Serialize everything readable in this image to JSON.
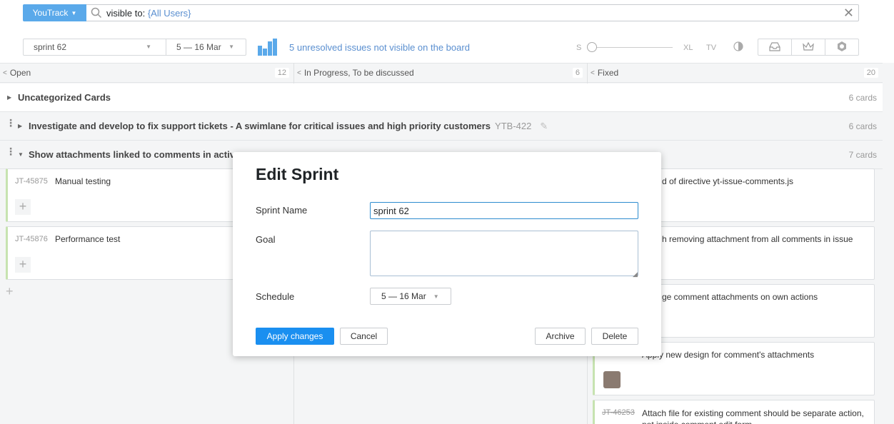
{
  "search": {
    "app_button": "YouTrack",
    "query_keyword": "visible to: ",
    "query_value": "{All Users}"
  },
  "toolbar": {
    "sprint": "sprint 62",
    "dates": "5 — 16 Mar",
    "unresolved_link": "5 unresolved issues not visible on the board",
    "size_s": "S",
    "size_xl": "XL",
    "size_tv": "TV"
  },
  "columns": [
    {
      "name": "Open",
      "count": "12"
    },
    {
      "name": "In Progress, To be discussed",
      "count": "6"
    },
    {
      "name": "Fixed",
      "count": "20"
    }
  ],
  "swimlanes": [
    {
      "title": "Uncategorized Cards",
      "cards": "6 cards"
    },
    {
      "title": "Investigate and develop to fix support tickets - A swimlane for critical issues and high priority customers",
      "id": "YTB-422",
      "cards": "6 cards"
    },
    {
      "title": "Show attachments linked to comments in activ",
      "cards": "7 cards"
    }
  ],
  "cards": [
    {
      "id": "JT-45875",
      "summary": "Manual testing"
    },
    {
      "id": "JT-45876",
      "summary": "Performance test"
    },
    {
      "summary": "d of directive yt-issue-comments.js"
    },
    {
      "summary": "h removing attachment from all comments in issue"
    },
    {
      "summary": "ge comment attachments on own actions"
    },
    {
      "summary": "Apply new design for comment's attachments"
    },
    {
      "id": "JT-46253",
      "summary": "Attach file for existing comment should be separate action, not inside comment edit form"
    }
  ],
  "modal": {
    "title": "Edit Sprint",
    "name_label": "Sprint Name",
    "name_value": "sprint 62",
    "goal_label": "Goal",
    "goal_value": "",
    "schedule_label": "Schedule",
    "schedule_value": "5 — 16 Mar",
    "apply": "Apply changes",
    "cancel": "Cancel",
    "archive": "Archive",
    "delete": "Delete"
  },
  "colors": {
    "accent": "#1a8ff0",
    "app_button": "#5aa9ea",
    "link": "#5a8fd0",
    "card_stripe": "#c7e3b0"
  }
}
